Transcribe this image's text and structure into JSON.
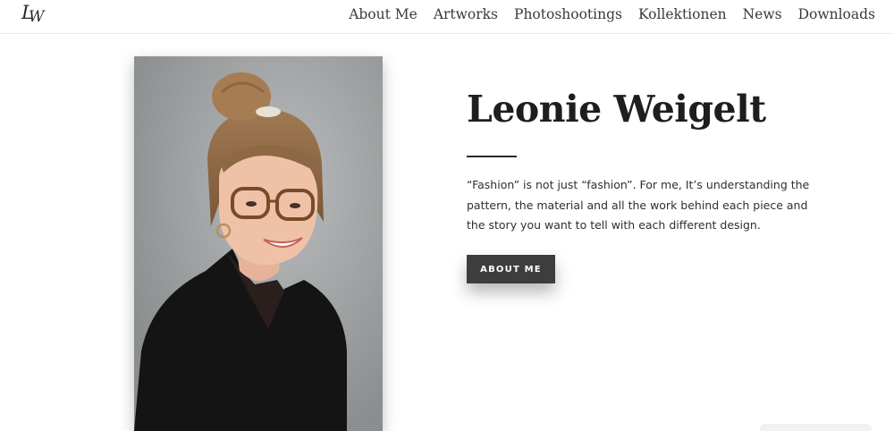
{
  "header": {
    "logo_text": "LW",
    "nav": [
      {
        "label": "About Me"
      },
      {
        "label": "Artworks"
      },
      {
        "label": "Photoshootings"
      },
      {
        "label": "Kollektionen"
      },
      {
        "label": "News"
      },
      {
        "label": "Downloads"
      }
    ]
  },
  "hero": {
    "name": "Leonie Weigelt",
    "intro": "“Fashion” is not just “fashion”. For me, It’s understanding the pattern, the material and all the work behind each piece and the story you want to tell with each different design.",
    "button_label": "ABOUT ME"
  },
  "colors": {
    "background": "#ffffff",
    "text_dark": "#1e1e1e",
    "button_bg": "#3d3d3d",
    "photo_backdrop": "#9ea1a2"
  }
}
